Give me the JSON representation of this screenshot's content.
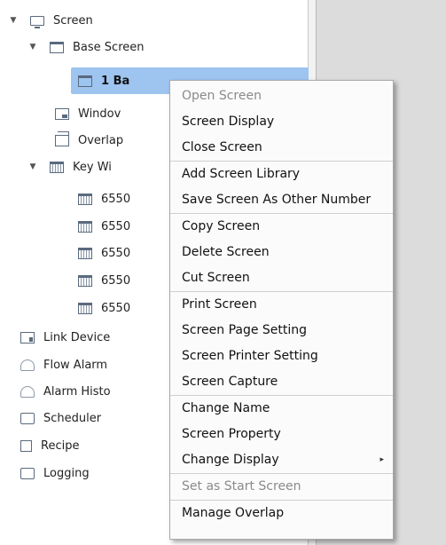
{
  "tree": {
    "screen": "Screen",
    "base_screen": "Base Screen",
    "selected_item": "1 Ba",
    "window": "Windov",
    "overlap": "Overlap",
    "key_window": "Key Wi",
    "key_items": [
      "6550",
      "6550",
      "6550",
      "6550",
      "6550"
    ],
    "link_device": "Link Device",
    "flow_alarm": "Flow Alarm",
    "alarm_history": "Alarm Histo",
    "scheduler": "Scheduler",
    "recipe": "Recipe",
    "logging": "Logging"
  },
  "context_menu": {
    "items": [
      "Open Screen",
      "Screen Display",
      "Close Screen",
      "Add Screen Library",
      "Save Screen As Other Number",
      "Copy Screen",
      "Delete Screen",
      "Cut Screen",
      "Print Screen",
      "Screen Page Setting",
      "Screen Printer Setting",
      "Screen Capture",
      "Change Name",
      "Screen Property",
      "Change Display",
      "Set as Start Screen",
      "Manage Overlap"
    ],
    "submenu_arrow": "▸"
  },
  "icons": {
    "expand_arrow": "▼"
  },
  "colors": {
    "selection": "#9ec4f0",
    "right_panel": "#dcdcdc",
    "disabled_text": "#8a8a8a"
  }
}
